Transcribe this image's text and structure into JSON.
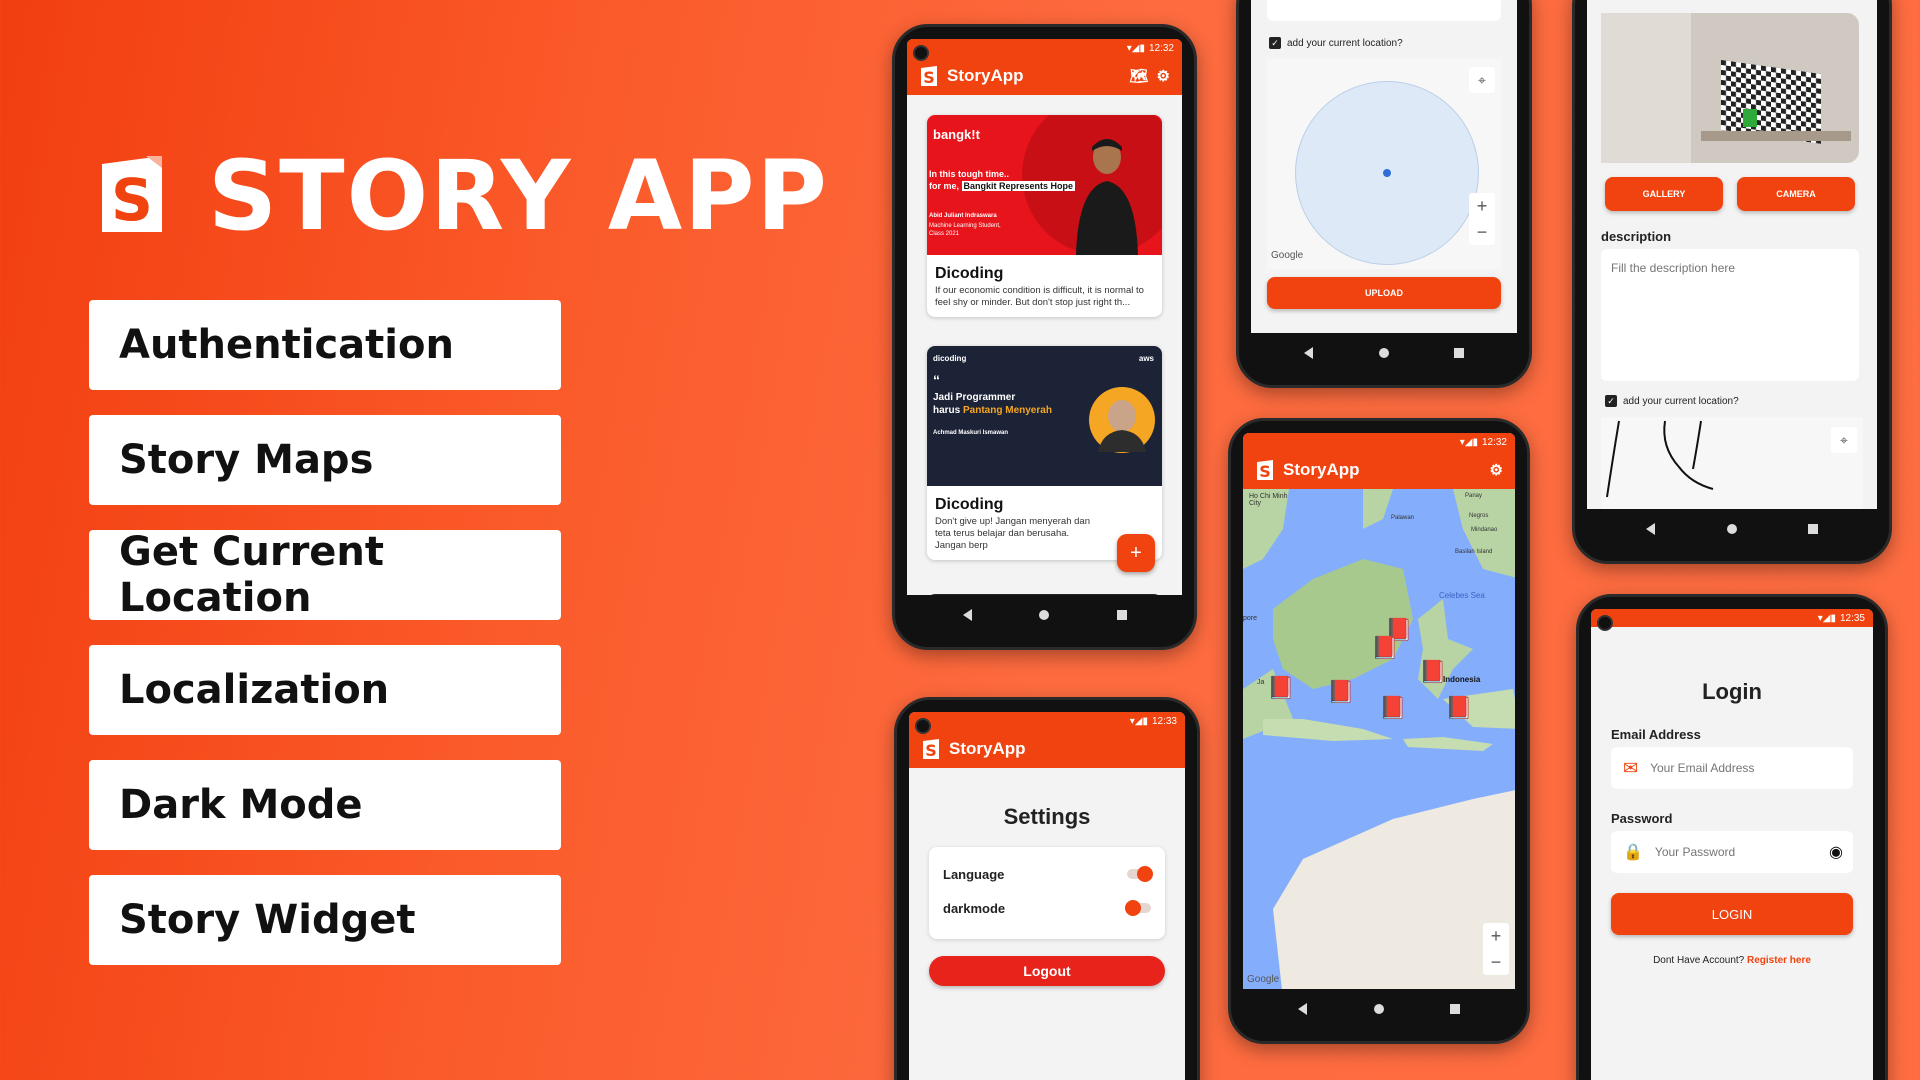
{
  "hero": {
    "title": "STORY APP",
    "features": [
      "Authentication",
      "Story Maps",
      "Get Current Location",
      "Localization",
      "Dark Mode",
      "Story Widget"
    ]
  },
  "colors": {
    "brand": "#f0430f",
    "background": "#fd6b3f"
  },
  "status": {
    "time_home": "12:32",
    "time_map": "12:32",
    "time_settings": "12:33",
    "time_login": "12:35"
  },
  "app": {
    "name": "StoryApp"
  },
  "home": {
    "stories": [
      {
        "name": "Dicoding",
        "description": "If our economic condition is difficult, it is normal to feel shy or minder. But don't stop just right th...",
        "banner": {
          "brand": "bangk!t",
          "line1": "In this tough time..",
          "line2": "for me, ",
          "highlight": "Bangkit Represents Hope",
          "person": "Abid Juliant Indraswara",
          "role": "Machine Learning Student,",
          "cohort": "Class 2021"
        }
      },
      {
        "name": "Dicoding",
        "description": "Don't give up! Jangan menyerah dan teta terus belajar dan berusaha. Jangan berp",
        "banner": {
          "brand": "dicoding",
          "partner": "aws",
          "line1": "Jadi Programmer",
          "line2": "harus ",
          "highlight": "Pantang Menyerah",
          "person": "Achmad Maskuri Ismawan"
        }
      }
    ],
    "fab_label": "+"
  },
  "upload_location": {
    "checkbox_label": "add your current location?",
    "upload_label": "UPLOAD",
    "google_label": "Google"
  },
  "map": {
    "labels": {
      "city": "Ho Chi Minh City",
      "palawan": "Palawan",
      "panay": "Panay",
      "negros": "Negros",
      "mindanao": "Mindanao",
      "basilan": "Basilan Island",
      "celebes": "Celebes Sea",
      "indonesia": "Indonesia",
      "pore": "pore",
      "ja": "Ja"
    },
    "google_label": "Google"
  },
  "add_story": {
    "gallery_label": "GALLERY",
    "camera_label": "CAMERA",
    "description_label": "description",
    "description_placeholder": "Fill the description here",
    "checkbox_label": "add your current location?"
  },
  "settings": {
    "title": "Settings",
    "language_label": "Language",
    "darkmode_label": "darkmode",
    "logout_label": "Logout"
  },
  "login": {
    "title": "Login",
    "email_label": "Email Address",
    "email_placeholder": "Your Email Address",
    "password_label": "Password",
    "password_placeholder": "Your Password",
    "login_label": "LOGIN",
    "no_account": "Dont Have Account?",
    "register_label": "Register here"
  }
}
